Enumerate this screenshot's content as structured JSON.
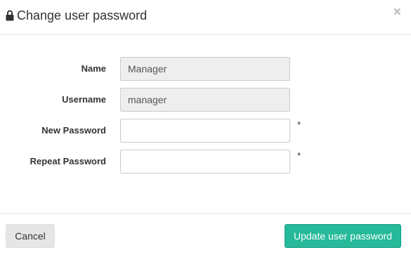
{
  "dialog": {
    "title": "Change user password",
    "title_icon": "lock-icon",
    "close_label": "×"
  },
  "form": {
    "fields": [
      {
        "label": "Name",
        "value": "Manager",
        "readonly": true,
        "required": false
      },
      {
        "label": "Username",
        "value": "manager",
        "readonly": true,
        "required": false
      },
      {
        "label": "New Password",
        "value": "",
        "readonly": false,
        "required": true
      },
      {
        "label": "Repeat Password",
        "value": "",
        "readonly": false,
        "required": true
      }
    ],
    "required_marker": "*"
  },
  "footer": {
    "cancel_label": "Cancel",
    "submit_label": "Update user password"
  },
  "colors": {
    "primary": "#26b99a",
    "readonly_bg": "#eeeeee",
    "cancel_bg": "#e6e6e6"
  }
}
